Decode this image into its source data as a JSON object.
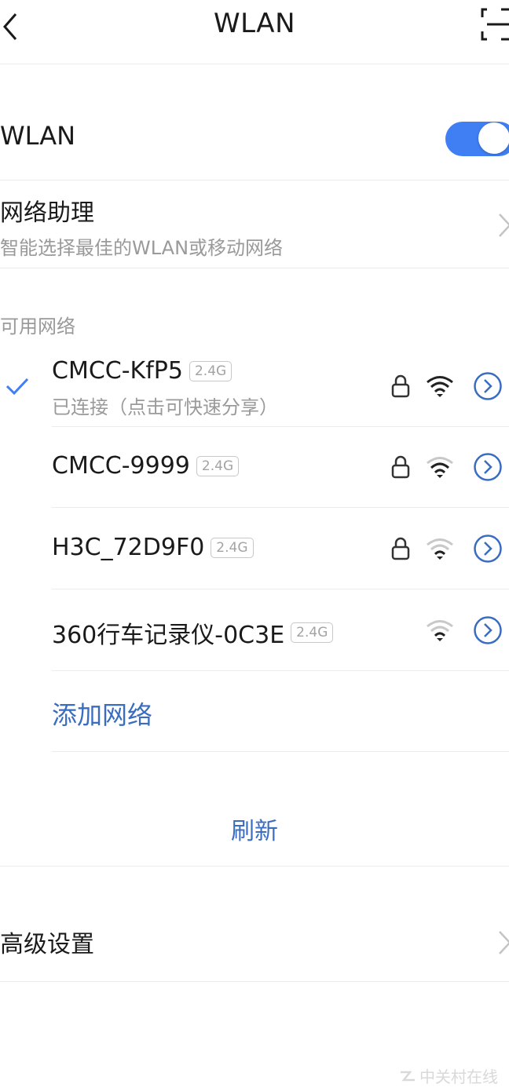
{
  "header": {
    "title": "WLAN"
  },
  "wlan_switch": {
    "label": "WLAN",
    "on": true
  },
  "assistant": {
    "title": "网络助理",
    "subtitle": "智能选择最佳的WLAN或移动网络"
  },
  "section_label": "可用网络",
  "networks": [
    {
      "name": "CMCC-KfP5",
      "band": "2.4G",
      "status": "已连接（点击可快速分享）",
      "connected": true,
      "secured": true,
      "signal_icon": "wifi-strong-icon"
    },
    {
      "name": "CMCC-9999",
      "band": "2.4G",
      "secured": true,
      "signal_icon": "wifi-medium-icon"
    },
    {
      "name": "H3C_72D9F0",
      "band": "2.4G",
      "secured": true,
      "signal_icon": "wifi-weak-icon"
    },
    {
      "name": "360行车记录仪-0C3E",
      "band": "2.4G",
      "secured": false,
      "signal_icon": "wifi-weak-icon"
    }
  ],
  "add_network": "添加网络",
  "refresh": "刷新",
  "advanced_settings": "高级设置",
  "watermark": "中关村在线",
  "colors": {
    "accent": "#3f7ff3",
    "link": "#3a6cc0",
    "secondary_text": "#9a9a9a"
  }
}
